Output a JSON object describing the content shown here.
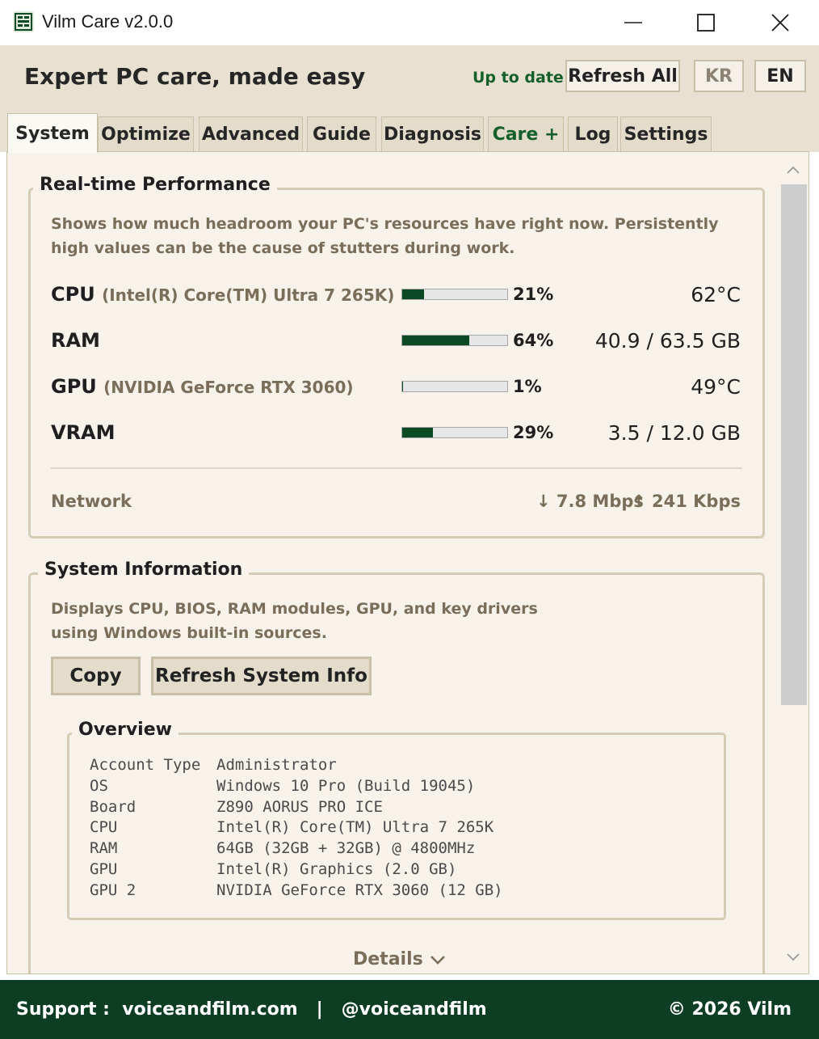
{
  "window": {
    "title": "Vilm Care v2.0.0"
  },
  "header": {
    "tagline": "Expert PC care, made easy",
    "status": "Up to date",
    "refresh_all": "Refresh All",
    "lang_kr": "KR",
    "lang_en": "EN"
  },
  "tabs": [
    {
      "label": "System",
      "active": true
    },
    {
      "label": "Optimize"
    },
    {
      "label": "Advanced"
    },
    {
      "label": "Guide"
    },
    {
      "label": "Diagnosis"
    },
    {
      "label": "Care +"
    },
    {
      "label": "Log"
    },
    {
      "label": "Settings"
    }
  ],
  "performance": {
    "title": "Real-time Performance",
    "description": "Shows how much headroom your PC's resources have right now. Persistently high values can be the cause of stutters during work.",
    "metrics": [
      {
        "name": "CPU",
        "detail": "(Intel(R) Core(TM) Ultra 7 265K)",
        "percent_label": "21%",
        "fraction": 0.21,
        "value": "62°C"
      },
      {
        "name": "RAM",
        "detail": "",
        "percent_label": "64%",
        "fraction": 0.64,
        "value": "40.9 / 63.5 GB"
      },
      {
        "name": "GPU",
        "detail": "(NVIDIA GeForce RTX 3060)",
        "percent_label": "1%",
        "fraction": 0.01,
        "value": "49°C"
      },
      {
        "name": "VRAM",
        "detail": "",
        "percent_label": "29%",
        "fraction": 0.29,
        "value": "3.5 / 12.0 GB"
      }
    ],
    "network": {
      "label": "Network",
      "down": "↓ 7.8 Mbps",
      "up": "↑ 241 Kbps"
    }
  },
  "system_info": {
    "title": "System Information",
    "description_line1": "Displays CPU, BIOS, RAM modules, GPU, and key drivers",
    "description_line2": "using Windows built-in sources.",
    "copy": "Copy",
    "refresh": "Refresh System Info",
    "overview": {
      "title": "Overview",
      "rows": [
        {
          "key": "Account Type",
          "value": "Administrator"
        },
        {
          "key": "OS",
          "value": "Windows 10 Pro (Build 19045)"
        },
        {
          "key": "Board",
          "value": "Z890 AORUS PRO ICE"
        },
        {
          "key": "CPU",
          "value": "Intel(R) Core(TM) Ultra 7 265K"
        },
        {
          "key": "RAM",
          "value": "64GB (32GB + 32GB) @ 4800MHz"
        },
        {
          "key": "GPU",
          "value": "Intel(R) Graphics (2.0 GB)"
        },
        {
          "key": "GPU 2",
          "value": "NVIDIA GeForce RTX 3060 (12 GB)"
        }
      ]
    },
    "details": "Details"
  },
  "footer": {
    "support": "Support :  voiceandfilm.com   |   @voiceandfilm",
    "copyright": "© 2026 Vilm"
  },
  "colors": {
    "accent_green": "#0c4a25",
    "footer_bg": "#0d3e23",
    "status_green": "#15602a",
    "header_bg": "#e8e1d2",
    "panel_bg": "#f7f3ea"
  }
}
